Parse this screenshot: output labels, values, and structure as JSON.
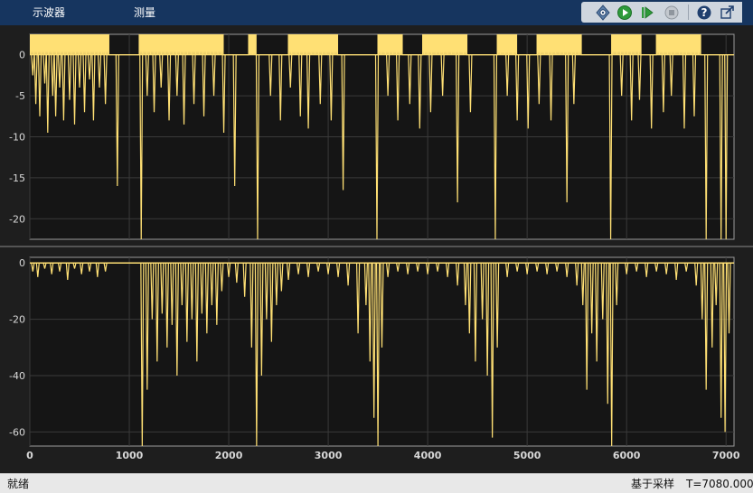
{
  "toolbar": {
    "tabs": [
      "示波器",
      "测量"
    ],
    "buttons": [
      "configuration-icon",
      "run-icon",
      "step-forward-icon",
      "stop-icon",
      "help-icon",
      "undock-icon"
    ]
  },
  "colors": {
    "trace": "#ffe074",
    "axes_bg": "#151515",
    "grid": "#3a3a3a",
    "toolbar": "#16355f"
  },
  "status": {
    "left": "就绪",
    "mode": "基于采样",
    "time": "T=7080.0000"
  },
  "chart_data": [
    {
      "type": "line",
      "x_range": [
        0,
        7080
      ],
      "ylim": [
        -22.5,
        2.5
      ],
      "yticks": [
        0,
        -5,
        -10,
        -15,
        -20
      ],
      "grid": true,
      "baseline": 0,
      "high_level": 2.5,
      "dense_blocks": [
        [
          0,
          800
        ],
        [
          1100,
          1950
        ],
        [
          2200,
          2280
        ],
        [
          2600,
          3100
        ],
        [
          3500,
          3750
        ],
        [
          3950,
          4400
        ],
        [
          4700,
          4900
        ],
        [
          5100,
          5550
        ],
        [
          5850,
          6150
        ],
        [
          6300,
          6750
        ]
      ],
      "dips": [
        [
          30,
          -2.5
        ],
        [
          60,
          -6
        ],
        [
          100,
          -7.5
        ],
        [
          150,
          -3.5
        ],
        [
          180,
          -9.5
        ],
        [
          230,
          -5
        ],
        [
          260,
          -7.5
        ],
        [
          300,
          -4
        ],
        [
          340,
          -8
        ],
        [
          400,
          -5.5
        ],
        [
          450,
          -8.5
        ],
        [
          500,
          -4
        ],
        [
          550,
          -7
        ],
        [
          600,
          -3
        ],
        [
          640,
          -8
        ],
        [
          700,
          -4
        ],
        [
          760,
          -6
        ],
        [
          880,
          -16
        ],
        [
          1120,
          -22.5
        ],
        [
          1180,
          -5
        ],
        [
          1250,
          -7
        ],
        [
          1320,
          -4
        ],
        [
          1400,
          -8
        ],
        [
          1480,
          -5
        ],
        [
          1550,
          -8.5
        ],
        [
          1650,
          -6
        ],
        [
          1750,
          -7.5
        ],
        [
          1850,
          -5
        ],
        [
          1950,
          -9.5
        ],
        [
          2060,
          -16
        ],
        [
          2290,
          -22.5
        ],
        [
          2420,
          -5
        ],
        [
          2520,
          -8
        ],
        [
          2620,
          -4
        ],
        [
          2720,
          -7.5
        ],
        [
          2800,
          -9
        ],
        [
          2920,
          -6
        ],
        [
          3030,
          -8
        ],
        [
          3150,
          -16.5
        ],
        [
          3490,
          -22.5
        ],
        [
          3600,
          -5
        ],
        [
          3700,
          -8
        ],
        [
          3820,
          -6
        ],
        [
          3920,
          -9
        ],
        [
          4030,
          -7
        ],
        [
          4150,
          -5
        ],
        [
          4300,
          -18
        ],
        [
          4430,
          -7
        ],
        [
          4680,
          -22.5
        ],
        [
          4800,
          -5
        ],
        [
          4900,
          -8
        ],
        [
          5010,
          -9
        ],
        [
          5120,
          -6
        ],
        [
          5240,
          -8
        ],
        [
          5400,
          -18
        ],
        [
          5470,
          -6
        ],
        [
          5840,
          -22.5
        ],
        [
          5950,
          -5
        ],
        [
          6050,
          -8
        ],
        [
          6130,
          -5.5
        ],
        [
          6250,
          -9
        ],
        [
          6370,
          -7
        ],
        [
          6450,
          -5
        ],
        [
          6580,
          -9
        ],
        [
          6680,
          -7.5
        ],
        [
          6800,
          -22.5
        ],
        [
          6950,
          -22.5
        ],
        [
          7000,
          -22.5
        ]
      ]
    },
    {
      "type": "line",
      "x_range": [
        0,
        7080
      ],
      "ylim": [
        -65,
        2
      ],
      "yticks": [
        0,
        -20,
        -40,
        -60
      ],
      "xticks": [
        0,
        1000,
        2000,
        3000,
        4000,
        5000,
        6000,
        7000
      ],
      "grid": true,
      "baseline": 0,
      "dips": [
        [
          30,
          -3
        ],
        [
          80,
          -5
        ],
        [
          150,
          -2
        ],
        [
          220,
          -4
        ],
        [
          300,
          -3
        ],
        [
          380,
          -6
        ],
        [
          450,
          -2
        ],
        [
          520,
          -4
        ],
        [
          600,
          -3
        ],
        [
          680,
          -5
        ],
        [
          760,
          -3
        ],
        [
          1130,
          -65
        ],
        [
          1180,
          -45
        ],
        [
          1230,
          -20
        ],
        [
          1280,
          -35
        ],
        [
          1330,
          -18
        ],
        [
          1380,
          -30
        ],
        [
          1430,
          -22
        ],
        [
          1480,
          -40
        ],
        [
          1530,
          -15
        ],
        [
          1580,
          -28
        ],
        [
          1630,
          -20
        ],
        [
          1680,
          -35
        ],
        [
          1730,
          -18
        ],
        [
          1780,
          -25
        ],
        [
          1830,
          -15
        ],
        [
          1880,
          -22
        ],
        [
          1930,
          -10
        ],
        [
          2000,
          -5
        ],
        [
          2080,
          -7
        ],
        [
          2160,
          -12
        ],
        [
          2230,
          -30
        ],
        [
          2280,
          -65
        ],
        [
          2330,
          -40
        ],
        [
          2380,
          -20
        ],
        [
          2430,
          -28
        ],
        [
          2480,
          -15
        ],
        [
          2530,
          -10
        ],
        [
          2600,
          -6
        ],
        [
          2700,
          -4
        ],
        [
          2800,
          -5
        ],
        [
          2900,
          -3
        ],
        [
          3000,
          -4
        ],
        [
          3100,
          -5
        ],
        [
          3200,
          -8
        ],
        [
          3300,
          -25
        ],
        [
          3380,
          -15
        ],
        [
          3420,
          -35
        ],
        [
          3460,
          -55
        ],
        [
          3500,
          -65
        ],
        [
          3540,
          -30
        ],
        [
          3600,
          -5
        ],
        [
          3700,
          -3
        ],
        [
          3800,
          -4
        ],
        [
          3900,
          -3
        ],
        [
          4000,
          -4
        ],
        [
          4100,
          -3
        ],
        [
          4200,
          -5
        ],
        [
          4300,
          -8
        ],
        [
          4380,
          -15
        ],
        [
          4420,
          -25
        ],
        [
          4480,
          -35
        ],
        [
          4550,
          -20
        ],
        [
          4600,
          -40
        ],
        [
          4650,
          -62
        ],
        [
          4700,
          -30
        ],
        [
          4800,
          -5
        ],
        [
          4900,
          -3
        ],
        [
          5000,
          -4
        ],
        [
          5100,
          -3
        ],
        [
          5200,
          -4
        ],
        [
          5300,
          -3
        ],
        [
          5400,
          -5
        ],
        [
          5500,
          -8
        ],
        [
          5560,
          -15
        ],
        [
          5600,
          -45
        ],
        [
          5650,
          -25
        ],
        [
          5700,
          -35
        ],
        [
          5760,
          -20
        ],
        [
          5810,
          -50
        ],
        [
          5850,
          -65
        ],
        [
          5900,
          -15
        ],
        [
          6000,
          -4
        ],
        [
          6100,
          -3
        ],
        [
          6200,
          -5
        ],
        [
          6300,
          -3
        ],
        [
          6400,
          -4
        ],
        [
          6500,
          -6
        ],
        [
          6600,
          -3
        ],
        [
          6700,
          -8
        ],
        [
          6760,
          -20
        ],
        [
          6800,
          -45
        ],
        [
          6860,
          -30
        ],
        [
          6900,
          -15
        ],
        [
          6950,
          -55
        ],
        [
          6990,
          -60
        ],
        [
          7030,
          -25
        ]
      ]
    }
  ]
}
